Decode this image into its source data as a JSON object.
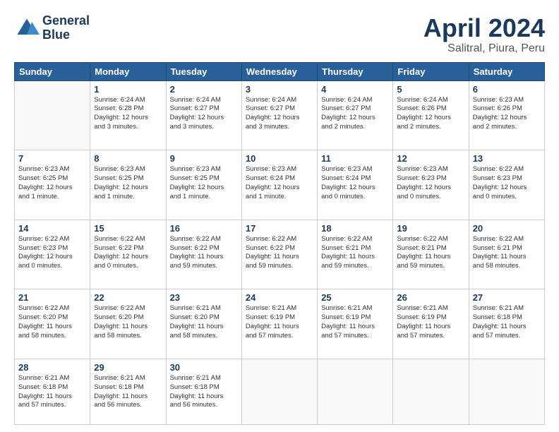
{
  "header": {
    "logo_line1": "General",
    "logo_line2": "Blue",
    "month_title": "April 2024",
    "location": "Salitral, Piura, Peru"
  },
  "weekdays": [
    "Sunday",
    "Monday",
    "Tuesday",
    "Wednesday",
    "Thursday",
    "Friday",
    "Saturday"
  ],
  "weeks": [
    [
      {
        "day": "",
        "info": ""
      },
      {
        "day": "1",
        "info": "Sunrise: 6:24 AM\nSunset: 6:28 PM\nDaylight: 12 hours\nand 3 minutes."
      },
      {
        "day": "2",
        "info": "Sunrise: 6:24 AM\nSunset: 6:27 PM\nDaylight: 12 hours\nand 3 minutes."
      },
      {
        "day": "3",
        "info": "Sunrise: 6:24 AM\nSunset: 6:27 PM\nDaylight: 12 hours\nand 3 minutes."
      },
      {
        "day": "4",
        "info": "Sunrise: 6:24 AM\nSunset: 6:27 PM\nDaylight: 12 hours\nand 2 minutes."
      },
      {
        "day": "5",
        "info": "Sunrise: 6:24 AM\nSunset: 6:26 PM\nDaylight: 12 hours\nand 2 minutes."
      },
      {
        "day": "6",
        "info": "Sunrise: 6:23 AM\nSunset: 6:26 PM\nDaylight: 12 hours\nand 2 minutes."
      }
    ],
    [
      {
        "day": "7",
        "info": "Sunrise: 6:23 AM\nSunset: 6:25 PM\nDaylight: 12 hours\nand 1 minute."
      },
      {
        "day": "8",
        "info": "Sunrise: 6:23 AM\nSunset: 6:25 PM\nDaylight: 12 hours\nand 1 minute."
      },
      {
        "day": "9",
        "info": "Sunrise: 6:23 AM\nSunset: 6:25 PM\nDaylight: 12 hours\nand 1 minute."
      },
      {
        "day": "10",
        "info": "Sunrise: 6:23 AM\nSunset: 6:24 PM\nDaylight: 12 hours\nand 1 minute."
      },
      {
        "day": "11",
        "info": "Sunrise: 6:23 AM\nSunset: 6:24 PM\nDaylight: 12 hours\nand 0 minutes."
      },
      {
        "day": "12",
        "info": "Sunrise: 6:23 AM\nSunset: 6:23 PM\nDaylight: 12 hours\nand 0 minutes."
      },
      {
        "day": "13",
        "info": "Sunrise: 6:22 AM\nSunset: 6:23 PM\nDaylight: 12 hours\nand 0 minutes."
      }
    ],
    [
      {
        "day": "14",
        "info": "Sunrise: 6:22 AM\nSunset: 6:23 PM\nDaylight: 12 hours\nand 0 minutes."
      },
      {
        "day": "15",
        "info": "Sunrise: 6:22 AM\nSunset: 6:22 PM\nDaylight: 12 hours\nand 0 minutes."
      },
      {
        "day": "16",
        "info": "Sunrise: 6:22 AM\nSunset: 6:22 PM\nDaylight: 11 hours\nand 59 minutes."
      },
      {
        "day": "17",
        "info": "Sunrise: 6:22 AM\nSunset: 6:22 PM\nDaylight: 11 hours\nand 59 minutes."
      },
      {
        "day": "18",
        "info": "Sunrise: 6:22 AM\nSunset: 6:21 PM\nDaylight: 11 hours\nand 59 minutes."
      },
      {
        "day": "19",
        "info": "Sunrise: 6:22 AM\nSunset: 6:21 PM\nDaylight: 11 hours\nand 59 minutes."
      },
      {
        "day": "20",
        "info": "Sunrise: 6:22 AM\nSunset: 6:21 PM\nDaylight: 11 hours\nand 58 minutes."
      }
    ],
    [
      {
        "day": "21",
        "info": "Sunrise: 6:22 AM\nSunset: 6:20 PM\nDaylight: 11 hours\nand 58 minutes."
      },
      {
        "day": "22",
        "info": "Sunrise: 6:22 AM\nSunset: 6:20 PM\nDaylight: 11 hours\nand 58 minutes."
      },
      {
        "day": "23",
        "info": "Sunrise: 6:21 AM\nSunset: 6:20 PM\nDaylight: 11 hours\nand 58 minutes."
      },
      {
        "day": "24",
        "info": "Sunrise: 6:21 AM\nSunset: 6:19 PM\nDaylight: 11 hours\nand 57 minutes."
      },
      {
        "day": "25",
        "info": "Sunrise: 6:21 AM\nSunset: 6:19 PM\nDaylight: 11 hours\nand 57 minutes."
      },
      {
        "day": "26",
        "info": "Sunrise: 6:21 AM\nSunset: 6:19 PM\nDaylight: 11 hours\nand 57 minutes."
      },
      {
        "day": "27",
        "info": "Sunrise: 6:21 AM\nSunset: 6:18 PM\nDaylight: 11 hours\nand 57 minutes."
      }
    ],
    [
      {
        "day": "28",
        "info": "Sunrise: 6:21 AM\nSunset: 6:18 PM\nDaylight: 11 hours\nand 57 minutes."
      },
      {
        "day": "29",
        "info": "Sunrise: 6:21 AM\nSunset: 6:18 PM\nDaylight: 11 hours\nand 56 minutes."
      },
      {
        "day": "30",
        "info": "Sunrise: 6:21 AM\nSunset: 6:18 PM\nDaylight: 11 hours\nand 56 minutes."
      },
      {
        "day": "",
        "info": ""
      },
      {
        "day": "",
        "info": ""
      },
      {
        "day": "",
        "info": ""
      },
      {
        "day": "",
        "info": ""
      }
    ]
  ]
}
